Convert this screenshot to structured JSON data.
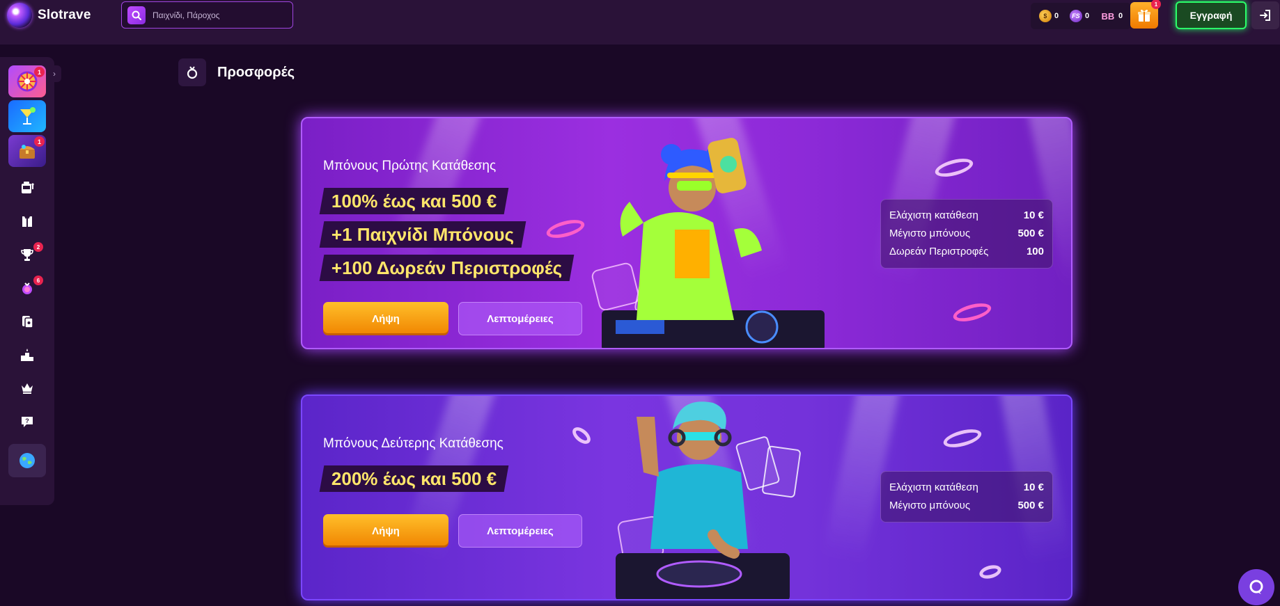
{
  "header": {
    "brand": "Slotrave",
    "search_placeholder": "Παιχνίδι, Πάροχος",
    "balances": [
      {
        "icon": "gold-coin-icon",
        "value": "0"
      },
      {
        "icon": "free-spins-coin-icon",
        "value": "0"
      },
      {
        "icon": "bonus-buy-icon",
        "value": "0"
      }
    ],
    "gift_badge": "1",
    "register_label": "Εγγραφή"
  },
  "sidebar": {
    "tiles": [
      {
        "name": "wheel",
        "badge": "1"
      },
      {
        "name": "cocktail",
        "badge": ""
      },
      {
        "name": "treasure-chest",
        "badge": "1"
      }
    ],
    "icons": [
      {
        "name": "slot-machine-icon",
        "badge": ""
      },
      {
        "name": "card-suits-icon",
        "badge": ""
      },
      {
        "name": "trophy-icon",
        "badge": "2"
      },
      {
        "name": "bonus-bag-icon",
        "badge": "6"
      },
      {
        "name": "cards-icon",
        "badge": ""
      },
      {
        "name": "podium-icon",
        "badge": ""
      },
      {
        "name": "crown-icon",
        "badge": ""
      },
      {
        "name": "support-chat-icon",
        "badge": ""
      }
    ]
  },
  "page": {
    "title": "Προσφορές"
  },
  "promos": [
    {
      "title": "Μπόνους Πρώτης Κατάθεσης",
      "lines": [
        "100% έως και 500 €",
        "+1 Παιχνίδι Μπόνους",
        "+100 Δωρεάν Περιστροφές"
      ],
      "claim_label": "Λήψη",
      "details_label": "Λεπτομέρειες",
      "info": [
        {
          "label": "Ελάχιστη κατάθεση",
          "value": "10 €"
        },
        {
          "label": "Μέγιστο μπόνους",
          "value": "500 €"
        },
        {
          "label": "Δωρεάν Περιστροφές",
          "value": "100"
        }
      ]
    },
    {
      "title": "Μπόνους Δεύτερης Κατάθεσης",
      "lines": [
        "200% έως και 500 €"
      ],
      "claim_label": "Λήψη",
      "details_label": "Λεπτομέρειες",
      "info": [
        {
          "label": "Ελάχιστη κατάθεση",
          "value": "10 €"
        },
        {
          "label": "Μέγιστο μπόνους",
          "value": "500 €"
        }
      ]
    }
  ],
  "colors": {
    "background": "#1a0826",
    "header": "#2a1238",
    "claim_button": "#f08400",
    "register_border": "#2bff6a",
    "badge": "#e8234f"
  }
}
